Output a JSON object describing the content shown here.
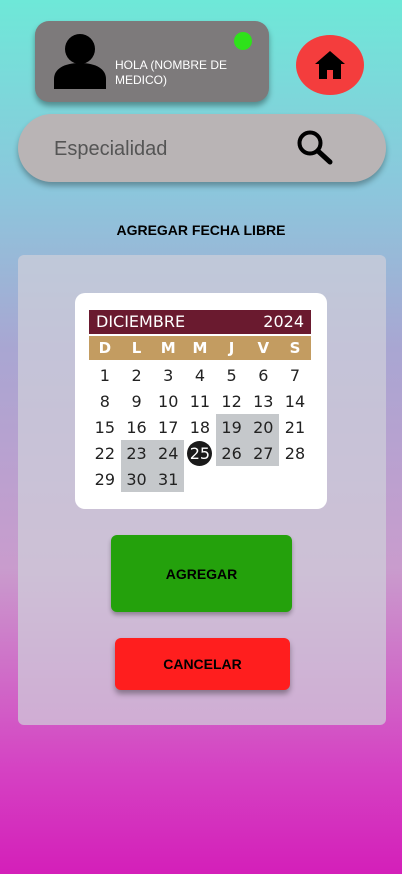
{
  "profile": {
    "greeting": "HOLA (NOMBRE DE MEDICO)",
    "avatar_icon": "person-icon",
    "status_color": "#2ee21a"
  },
  "home": {
    "icon": "home-icon",
    "color": "#f43d3d"
  },
  "search": {
    "placeholder": "Especialidad",
    "value": "",
    "icon": "search-icon"
  },
  "title": "AGREGAR FECHA LIBRE",
  "calendar": {
    "month": "DICIEMBRE",
    "year": "2024",
    "weekdays": [
      "D",
      "L",
      "M",
      "M",
      "J",
      "V",
      "S"
    ],
    "days": [
      "1",
      "2",
      "3",
      "4",
      "5",
      "6",
      "7",
      "8",
      "9",
      "10",
      "11",
      "12",
      "13",
      "14",
      "15",
      "16",
      "17",
      "18",
      "19",
      "20",
      "21",
      "22",
      "23",
      "24",
      "25",
      "26",
      "27",
      "28",
      "29",
      "30",
      "31"
    ],
    "selected_day": "25",
    "range_days": [
      "23",
      "24",
      "30",
      "31",
      "19",
      "20",
      "26",
      "27"
    ],
    "header_color": "#6a1a2f",
    "weekday_color": "#c39c61"
  },
  "buttons": {
    "add": "AGREGAR",
    "cancel": "CANCELAR"
  }
}
